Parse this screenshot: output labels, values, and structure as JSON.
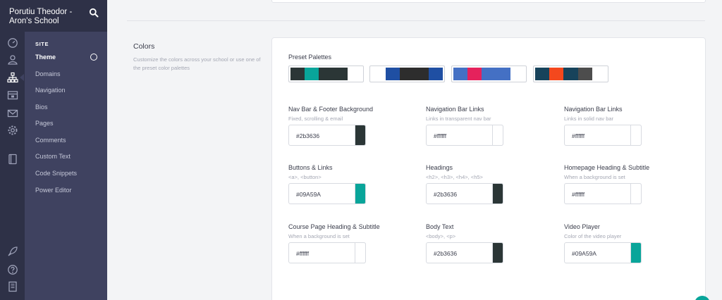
{
  "school": {
    "name": "Porutiu Theodor - Aron's School"
  },
  "rail_icons": [
    "dashboard-icon",
    "users-icon",
    "site-icon",
    "products-icon",
    "mail-icon",
    "settings-icon",
    "book-icon",
    "rocket-icon",
    "help-icon",
    "building-icon"
  ],
  "subnav": {
    "heading": "SITE",
    "items": [
      {
        "label": "Theme",
        "active": true
      },
      {
        "label": "Domains"
      },
      {
        "label": "Navigation"
      },
      {
        "label": "Bios"
      },
      {
        "label": "Pages"
      },
      {
        "label": "Comments"
      },
      {
        "label": "Custom Text"
      },
      {
        "label": "Code Snippets"
      },
      {
        "label": "Power Editor"
      }
    ]
  },
  "section": {
    "title": "Colors",
    "description": "Customize the colors across your school or use one of the preset color palettes"
  },
  "preset": {
    "label": "Preset Palettes",
    "palettes": [
      [
        "#2b3636",
        "#09a59a",
        "#2b3636",
        "#2b3636",
        "#ffffff"
      ],
      [
        "#ffffff",
        "#1f4fa3",
        "#2d2d2d",
        "#2d2d2d",
        "#1f4fa3"
      ],
      [
        "#4470c4",
        "#e5225c",
        "#4470c4",
        "#4470c4",
        "#ffffff"
      ],
      [
        "#17435b",
        "#f4481d",
        "#17435b",
        "#4d4d4d",
        "#ffffff"
      ]
    ]
  },
  "fields": [
    {
      "label": "Nav Bar & Footer Background",
      "hint": "Fixed, scrolling & email",
      "value": "#2b3636",
      "color": "#2b3636"
    },
    {
      "label": "Navigation Bar Links",
      "hint": "Links in transparent nav bar",
      "value": "#ffffff",
      "color": "#ffffff"
    },
    {
      "label": "Navigation Bar Links",
      "hint": "Links in solid nav bar",
      "value": "#ffffff",
      "color": "#ffffff"
    },
    {
      "label": "Buttons & Links",
      "hint": "<a>, <button>",
      "value": "#09A59A",
      "color": "#09a59a"
    },
    {
      "label": "Headings",
      "hint": "<h2>, <h3>, <h4>, <h5>",
      "value": "#2b3636",
      "color": "#2b3636"
    },
    {
      "label": "Homepage Heading & Subtitle",
      "hint": "When a background is set",
      "value": "#ffffff",
      "color": "#ffffff"
    },
    {
      "label": "Course Page Heading & Subtitle",
      "hint": "When a background is set",
      "value": "#ffffff",
      "color": "#ffffff"
    },
    {
      "label": "Body Text",
      "hint": "<body>, <p>",
      "value": "#2b3636",
      "color": "#2b3636"
    },
    {
      "label": "Video Player",
      "hint": "Color of the video player",
      "value": "#09A59A",
      "color": "#09a59a"
    }
  ],
  "colors": {
    "rail": "#2e3147",
    "subnav": "#3f4260",
    "accent": "#09a59a"
  }
}
